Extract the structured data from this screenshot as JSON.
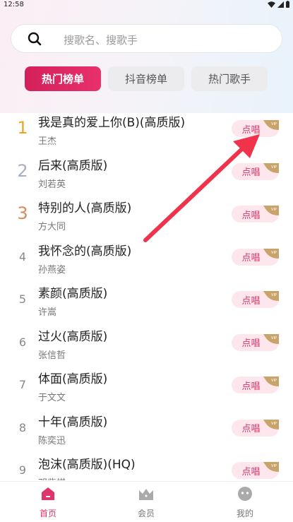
{
  "status_bar": {
    "time": "12:58"
  },
  "search": {
    "placeholder": "搜歌名、搜歌手",
    "icon": "search-icon"
  },
  "tabs": [
    {
      "label": "热门榜单",
      "active": true
    },
    {
      "label": "抖音榜单",
      "active": false
    },
    {
      "label": "热门歌手",
      "active": false
    }
  ],
  "songs": [
    {
      "rank": "1",
      "title": "我是真的爱上你(B)(高质版)",
      "artist": "王杰",
      "button": "点唱",
      "rank_color": "#f0a520"
    },
    {
      "rank": "2",
      "title": "后来(高质版)",
      "artist": "刘若英",
      "button": "点唱",
      "rank_color": "#a8b0c0"
    },
    {
      "rank": "3",
      "title": "特别的人(高质版)",
      "artist": "方大同",
      "button": "点唱",
      "rank_color": "#d98b5a"
    },
    {
      "rank": "4",
      "title": "我怀念的(高质版)",
      "artist": "孙燕姿",
      "button": "点唱",
      "rank_color": "#888888"
    },
    {
      "rank": "5",
      "title": "素颜(高质版)",
      "artist": "许嵩",
      "button": "点唱",
      "rank_color": "#888888"
    },
    {
      "rank": "6",
      "title": "过火(高质版)",
      "artist": "张信哲",
      "button": "点唱",
      "rank_color": "#888888"
    },
    {
      "rank": "7",
      "title": "体面(高质版)",
      "artist": "于文文",
      "button": "点唱",
      "rank_color": "#888888"
    },
    {
      "rank": "8",
      "title": "十年(高质版)",
      "artist": "陈奕迅",
      "button": "点唱",
      "rank_color": "#888888"
    },
    {
      "rank": "9",
      "title": "泡沫(高质版)(HQ)",
      "artist": "邓紫棋",
      "button": "点唱",
      "rank_color": "#888888"
    }
  ],
  "vip_badge": "VIP",
  "bottom_nav": [
    {
      "label": "首页",
      "icon": "home-icon",
      "active": true
    },
    {
      "label": "会员",
      "icon": "crown-icon",
      "active": false
    },
    {
      "label": "我的",
      "icon": "profile-icon",
      "active": false
    }
  ],
  "colors": {
    "accent": "#e0356a",
    "tab_active": "#d4205a",
    "arrow": "#f0324a"
  }
}
